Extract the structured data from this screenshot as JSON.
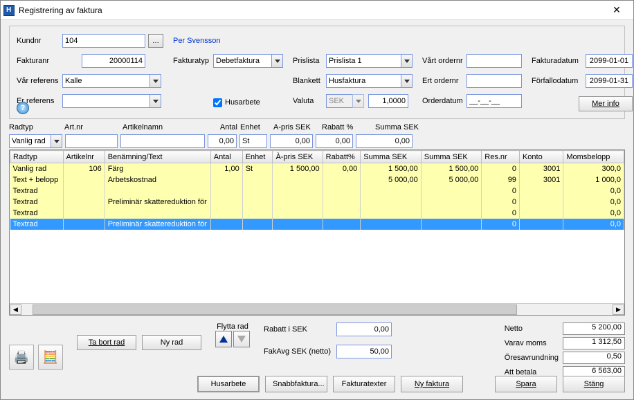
{
  "title": "Registrering av faktura",
  "labels": {
    "kundnr": "Kundnr",
    "fakturanr": "Fakturanr",
    "var_referens": "Vår referens",
    "er_referens": "Er referens",
    "fakturatyp": "Fakturatyp",
    "husarbete": "Husarbete",
    "prislista": "Prislista",
    "blankett": "Blankett",
    "valuta": "Valuta",
    "vart_ordernr": "Vårt ordernr",
    "ert_ordernr": "Ert ordernr",
    "orderdatum": "Orderdatum",
    "fakturadatum": "Fakturadatum",
    "forfallodatum": "Förfallodatum",
    "mer_info": "Mer info",
    "per_svensson": "Per Svensson"
  },
  "values": {
    "kundnr": "104",
    "fakturanr": "20000114",
    "var_referens": "Kalle",
    "er_referens": "",
    "fakturatyp": "Debetfaktura",
    "prislista": "Prislista 1",
    "blankett": "Husfaktura",
    "valuta": "SEK",
    "valuta_kurs": "1,0000",
    "vart_ordernr": "",
    "ert_ordernr": "",
    "orderdatum": "__-__-__",
    "fakturadatum": "2099-01-01",
    "forfallodatum": "2099-01-31"
  },
  "entry": {
    "radtyp_label": "Radtyp",
    "artnr_label": "Art.nr",
    "artikelnamn_label": "Artikelnamn",
    "antal_label": "Antal",
    "enhet_label": "Enhet",
    "apris_label": "A-pris SEK",
    "rabatt_label": "Rabatt %",
    "summa_label": "Summa SEK",
    "radtyp_value": "Vanlig rad",
    "artnr_value": "",
    "artikelnamn_value": "",
    "antal_value": "0,00",
    "enhet_value": "St",
    "apris_value": "0,00",
    "rabatt_value": "0,00",
    "summa_value": "0,00"
  },
  "grid": {
    "cols": [
      "Radtyp",
      "Artikelnr",
      "Benämning/Text",
      "Antal",
      "Enhet",
      "À-pris SEK",
      "Rabatt%",
      "Summa SEK",
      "Summa SEK",
      "Res.nr",
      "Konto",
      "Momsbelopp"
    ],
    "rows": [
      {
        "c": [
          "Vanlig rad",
          "106",
          "Färg",
          "1,00",
          "St",
          "1 500,00",
          "0,00",
          "1 500,00",
          "1 500,00",
          "0",
          "3001",
          "300,0"
        ],
        "cls": "yellow"
      },
      {
        "c": [
          "Text + belopp",
          "",
          "Arbetskostnad",
          "",
          "",
          "",
          "",
          "5 000,00",
          "5 000,00",
          "99",
          "3001",
          "1 000,0"
        ],
        "cls": "yellow"
      },
      {
        "c": [
          "Textrad",
          "",
          "",
          "",
          "",
          "",
          "",
          "",
          "",
          "0",
          "",
          "0,0"
        ],
        "cls": "yellow"
      },
      {
        "c": [
          "Textrad",
          "",
          "Preliminär skattereduktion för",
          "",
          "",
          "",
          "",
          "",
          "",
          "0",
          "",
          "0,0"
        ],
        "cls": "yellow"
      },
      {
        "c": [
          "Textrad",
          "",
          "",
          "",
          "",
          "",
          "",
          "",
          "",
          "0",
          "",
          "0,0"
        ],
        "cls": "yellow"
      },
      {
        "c": [
          "Textrad",
          "",
          "Preliminär skattereduktion för",
          "",
          "",
          "",
          "",
          "",
          "",
          "0",
          "",
          "0,0"
        ],
        "cls": "sel"
      }
    ]
  },
  "buttons": {
    "ta_bort_rad": "Ta bort rad",
    "ny_rad": "Ny rad",
    "flytta_rad": "Flytta rad",
    "husarbete": "Husarbete",
    "snabbfaktura": "Snabbfaktura...",
    "fakturatexter": "Fakturatexter",
    "ny_faktura": "Ny faktura",
    "spara": "Spara",
    "stang": "Stäng"
  },
  "bottom": {
    "rabatt_label": "Rabatt i SEK",
    "rabatt_value": "0,00",
    "fakavg_label": "FakAvg SEK (netto)",
    "fakavg_value": "50,00",
    "netto_label": "Netto",
    "netto_value": "5 200,00",
    "moms_label": "Varav moms",
    "moms_value": "1 312,50",
    "ores_label": "Öresavrundning",
    "ores_value": "0,50",
    "att_betala_label": "Att betala",
    "att_betala_value": "6 563,00"
  }
}
